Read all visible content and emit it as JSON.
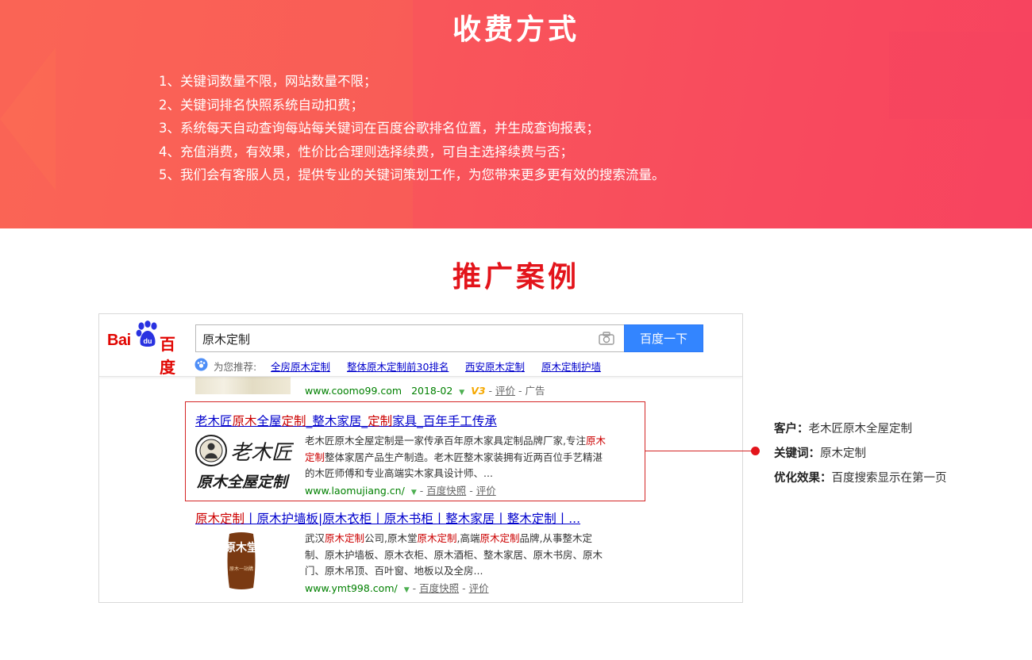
{
  "pricing": {
    "title": "收费方式",
    "items": [
      "1、关键词数量不限，网站数量不限；",
      "2、关键词排名快照系统自动扣费；",
      "3、系统每天自动查询每站每关键词在百度谷歌排名位置，并生成查询报表；",
      "4、充值消费，有效果，性价比合理则选择续费，可自主选择续费与否；",
      "5、我们会有客服人员，提供专业的关键词策划工作，为您带来更多更有效的搜索流量。"
    ]
  },
  "case": {
    "title": "推广案例",
    "info": {
      "client_label": "客户",
      "client_value": "老木匠原木全屋定制",
      "keyword_label": "关键词",
      "keyword_value": "原木定制",
      "effect_label": "优化效果",
      "effect_value": "百度搜索显示在第一页"
    }
  },
  "serp": {
    "logo_text": "Bai百度",
    "search_query": "原木定制",
    "search_button": "百度一下",
    "suggest_label": "为您推荐:",
    "suggestions": [
      "全房原木定制",
      "整体原木定制前30排名",
      "西安原木定制",
      "原木定制护墙"
    ],
    "partial_result": {
      "url": "www.coomo99.com",
      "date": "2018-02",
      "badge": "V3",
      "review": "评价",
      "ad": "广告"
    },
    "result1": {
      "title_parts": [
        "老木匠",
        "原木",
        "全屋",
        "定制",
        "_整木家居_",
        "定制",
        "家具_百年手工传承"
      ],
      "logo_text_1": "老木匠",
      "logo_text_2": "原木全屋定制",
      "snippet_1a": "老木匠原木全屋定制是一家传承百年原木家具定制品牌厂家,专注",
      "snippet_1b": "原木",
      "snippet_2a": "定制",
      "snippet_2b": "整体家居产品生产制造。老木匠整木家装拥有近两百位手艺精湛",
      "snippet_3": "的木匠师傅和专业高端实木家具设计师、...",
      "url": "www.laomujiang.cn/",
      "snapshot": "百度快照",
      "review": "评价"
    },
    "result2": {
      "title_parts": [
        "原木定制",
        "丨原木护墙板|原木衣柜丨原木书柜丨整木家居丨整木定制丨..."
      ],
      "logo_text": "原木堂",
      "logo_sub": "原木一站購",
      "snippet_1": [
        "武汉",
        "原木定制",
        "公司,原木堂",
        "原木定制",
        ",高端",
        "原木定制",
        "品牌,从事整木定"
      ],
      "snippet_2": "制、原木护墙板、原木衣柜、原木酒柜、整木家居、原木书房、原木",
      "snippet_3": "门、原木吊顶、百叶窗、地板以及全房...",
      "url": "www.ymt998.com/",
      "snapshot": "百度快照",
      "review": "评价"
    }
  },
  "colors": {
    "banner_start": "#fa6157",
    "banner_end": "#f7435f",
    "accent_red": "#e3141b",
    "link_blue": "#0000cc",
    "baidu_blue": "#3385ff",
    "url_green": "#008000"
  }
}
